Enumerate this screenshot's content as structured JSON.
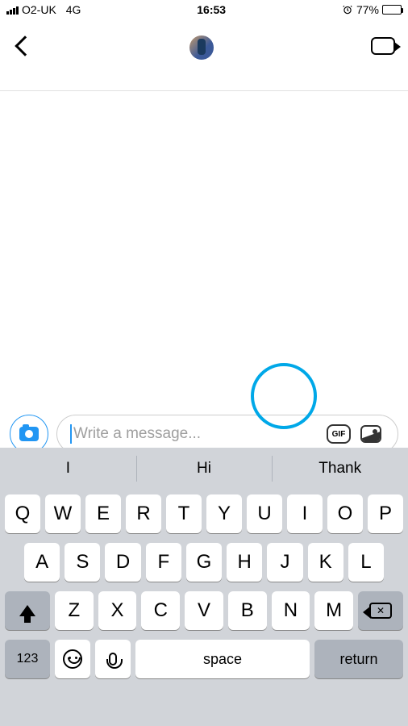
{
  "status": {
    "carrier": "O2-UK",
    "network": "4G",
    "time": "16:53",
    "battery_pct": "77%",
    "alarm": true
  },
  "nav": {
    "back": "Back",
    "video": "Video Call"
  },
  "composer": {
    "placeholder": "Write a message...",
    "gif_label": "GIF"
  },
  "suggestions": [
    "I",
    "Hi",
    "Thank"
  ],
  "keyboard": {
    "row1": [
      "Q",
      "W",
      "E",
      "R",
      "T",
      "Y",
      "U",
      "I",
      "O",
      "P"
    ],
    "row2": [
      "A",
      "S",
      "D",
      "F",
      "G",
      "H",
      "J",
      "K",
      "L"
    ],
    "row3": [
      "Z",
      "X",
      "C",
      "V",
      "B",
      "N",
      "M"
    ],
    "mode": "123",
    "space": "space",
    "return": "return"
  }
}
